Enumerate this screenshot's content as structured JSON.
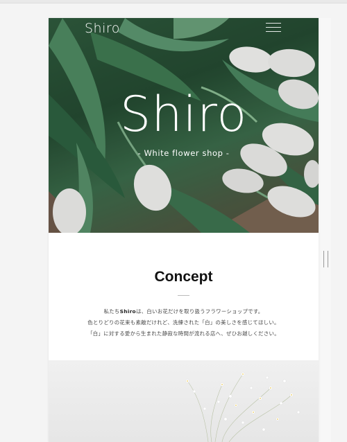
{
  "header": {
    "logo": "Shiro",
    "menu_icon": "hamburger-menu-icon"
  },
  "hero": {
    "title": "Shiro",
    "subtitle": "- White flower shop -"
  },
  "concept": {
    "title": "Concept",
    "line1_prefix": "私たち",
    "line1_brand": "Shiro",
    "line1_suffix": "は、白いお花だけを取り扱うフラワーショップです。",
    "line2": "色とりどりの花束も素敵だけれど、洗練された「白」の美しさを感じてほしい。",
    "line3": "「白」に対する愛から生まれた静寂な時間が流れる店へ、ぜひお越しください。"
  },
  "colors": {
    "page_bg": "#f4f4f4",
    "hero_green": "#2f5a3d",
    "text_dark": "#111111"
  }
}
